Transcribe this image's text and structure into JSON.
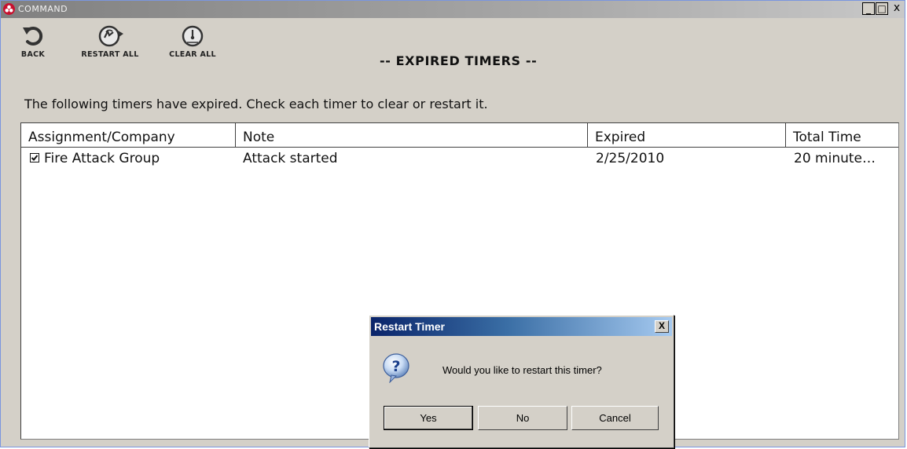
{
  "window": {
    "title": "COMMAND",
    "controls": {
      "minimize": "_",
      "maximize": "□",
      "close": "x"
    }
  },
  "toolbar": {
    "back_label": "BACK",
    "back_icon": "undo-arrow-icon",
    "restart_all_label": "RESTART ALL",
    "restart_all_icon": "restart-timer-icon",
    "clear_all_label": "CLEAR ALL",
    "clear_all_icon": "stopwatch-icon"
  },
  "page": {
    "heading": "-- EXPIRED TIMERS --",
    "instructions": "The following timers have expired. Check each timer to clear or restart it."
  },
  "table": {
    "columns": [
      "Assignment/Company",
      "Note",
      "Expired",
      "Total Time"
    ],
    "rows": [
      {
        "checked": true,
        "assignment": "Fire Attack Group",
        "note": "Attack started",
        "expired": "2/25/2010",
        "total_time": "20 minute…"
      }
    ]
  },
  "dialog": {
    "title": "Restart Timer",
    "close": "X",
    "icon": "question-icon",
    "message": "Would you like to restart this timer?",
    "buttons": {
      "yes": "Yes",
      "no": "No",
      "cancel": "Cancel"
    }
  },
  "colors": {
    "window_bg": "#d4d0c8",
    "app_icon": "#c8102e",
    "dialog_title_start": "#0a246a",
    "dialog_title_end": "#a6caf0"
  }
}
